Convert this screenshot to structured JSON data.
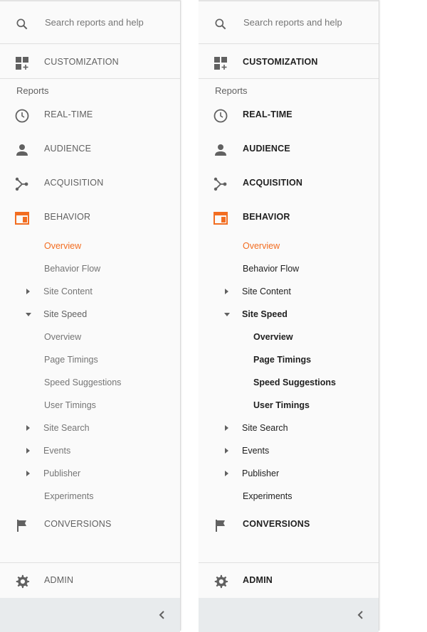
{
  "panels": [
    {
      "variant": "dimmed",
      "search_placeholder": "Search reports and help",
      "customization": "CUSTOMIZATION",
      "reports_heading": "Reports",
      "nav": {
        "realtime": "REAL-TIME",
        "audience": "AUDIENCE",
        "acquisition": "ACQUISITION",
        "behavior": "BEHAVIOR",
        "conversions": "CONVERSIONS",
        "admin": "ADMIN"
      },
      "behavior_items": {
        "overview": "Overview",
        "behavior_flow": "Behavior Flow",
        "site_content": "Site Content",
        "site_speed": "Site Speed",
        "site_speed_overview": "Overview",
        "page_timings": "Page Timings",
        "speed_suggestions": "Speed Suggestions",
        "user_timings": "User Timings",
        "site_search": "Site Search",
        "events": "Events",
        "publisher": "Publisher",
        "experiments": "Experiments"
      }
    },
    {
      "variant": "highlighted",
      "search_placeholder": "Search reports and help",
      "customization": "CUSTOMIZATION",
      "reports_heading": "Reports",
      "nav": {
        "realtime": "REAL-TIME",
        "audience": "AUDIENCE",
        "acquisition": "ACQUISITION",
        "behavior": "BEHAVIOR",
        "conversions": "CONVERSIONS",
        "admin": "ADMIN"
      },
      "behavior_items": {
        "overview": "Overview",
        "behavior_flow": "Behavior Flow",
        "site_content": "Site Content",
        "site_speed": "Site Speed",
        "site_speed_overview": "Overview",
        "page_timings": "Page Timings",
        "speed_suggestions": "Speed Suggestions",
        "user_timings": "User Timings",
        "site_search": "Site Search",
        "events": "Events",
        "publisher": "Publisher",
        "experiments": "Experiments"
      }
    }
  ],
  "colors": {
    "accent": "#f26d21",
    "icon_gray": "#616161",
    "footer_bg": "#e8ebed"
  },
  "icons": [
    "search-icon",
    "dashboard-icon",
    "clock-icon",
    "person-icon",
    "acquisition-icon",
    "behavior-icon",
    "flag-icon",
    "gear-icon",
    "chevron-left-icon"
  ]
}
